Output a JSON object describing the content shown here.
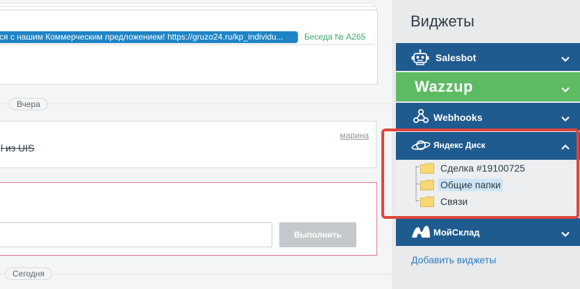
{
  "feed": {
    "message": {
      "text": "ся с нашим Коммерческим предложением!  https://gruzo24.ru/kp_individu...",
      "conversation": "Беседа № А265"
    },
    "yesterday_label": "Вчера",
    "note": {
      "author": "марина",
      "text": "l из UIS"
    },
    "task": {
      "input_value": "",
      "execute_label": "Выполнить"
    },
    "today_label": "Сегодня"
  },
  "widgets_panel": {
    "title": "Виджеты",
    "items": [
      {
        "label": "Salesbot",
        "icon": "robot-icon",
        "expanded": false
      },
      {
        "label": "Wazzup",
        "icon": "",
        "expanded": false
      },
      {
        "label": "Webhooks",
        "icon": "webhooks-icon",
        "expanded": false
      },
      {
        "label": "Яндекс Диск",
        "icon": "planet-icon",
        "expanded": true,
        "tree": [
          {
            "label": "Сделка #19100725",
            "selected": false
          },
          {
            "label": "Общие папки",
            "selected": true
          },
          {
            "label": "Связи",
            "selected": false
          }
        ]
      },
      {
        "label": "МойСклад",
        "icon": "moysklad-icon",
        "expanded": false
      }
    ],
    "add_widgets_label": "Добавить виджеты"
  },
  "colors": {
    "widget_header": "#1f5b8f",
    "wazzup_green": "#5dbb63",
    "highlight_red": "#e0453c",
    "message_blue": "#1e84c6",
    "link_blue": "#2e7dc2"
  }
}
